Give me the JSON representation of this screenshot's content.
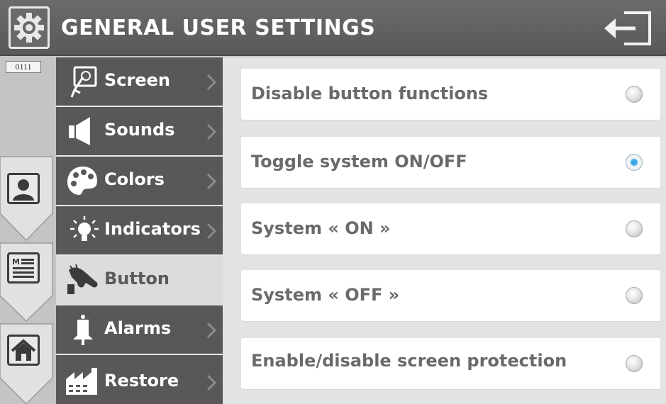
{
  "header": {
    "title": "GENERAL USER SETTINGS",
    "icon": "gear-icon",
    "exit_icon": "exit-icon"
  },
  "left_strip": {
    "code": "0111",
    "tabs": [
      {
        "icon": "user-icon"
      },
      {
        "icon": "menu-list-icon"
      },
      {
        "icon": "home-icon"
      }
    ]
  },
  "menu": {
    "items": [
      {
        "label": "Screen",
        "icon": "touch-screen-icon",
        "active": false
      },
      {
        "label": "Sounds",
        "icon": "speaker-icon",
        "active": false
      },
      {
        "label": "Colors",
        "icon": "palette-icon",
        "active": false
      },
      {
        "label": "Indicators",
        "icon": "light-bulb-icon",
        "active": false
      },
      {
        "label": "Button",
        "icon": "hand-press-icon",
        "active": true
      },
      {
        "label": "Alarms",
        "icon": "bell-icon",
        "active": false
      },
      {
        "label": "Restore",
        "icon": "factory-icon",
        "active": false
      }
    ]
  },
  "options": [
    {
      "label": "Disable button functions",
      "selected": false
    },
    {
      "label": "Toggle system ON/OFF",
      "selected": true
    },
    {
      "label": "System « ON »",
      "selected": false
    },
    {
      "label": "System « OFF »",
      "selected": false
    },
    {
      "label": "Enable/disable screen protection",
      "selected": false
    }
  ],
  "colors": {
    "header_bg": "#5f5e5c",
    "menu_bg": "#595856",
    "menu_active_bg": "#dcdcda",
    "content_bg": "#e2e4e1",
    "radio_selected": "#2f9ad6"
  }
}
